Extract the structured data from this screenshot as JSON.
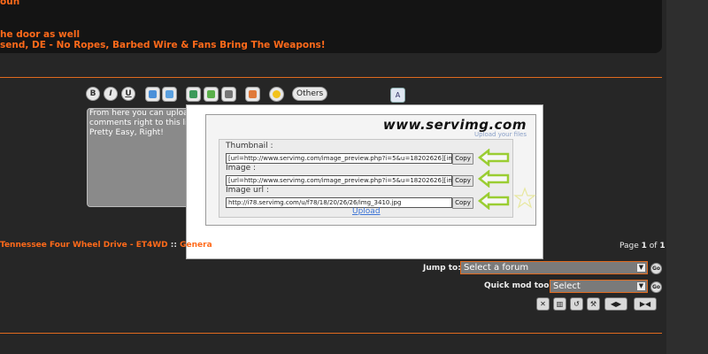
{
  "post": {
    "line1": "oun",
    "line2": "he door as well",
    "line3": "send, DE - No Ropes, Barbed Wire & Fans Bring The Weapons!"
  },
  "toolbar": {
    "bold": "B",
    "italic": "I",
    "underline": "U",
    "others_label": "Others",
    "font_label": "A"
  },
  "editor": {
    "line1": "From here you can uploa",
    "line2": "comments right to this liv",
    "line3": "Pretty Easy, Right!"
  },
  "servimg": {
    "logo": "www.servimg.com",
    "tagline": "Upload your files",
    "thumbnail_label": "Thumbnail :",
    "thumbnail_value": "[url=http://www.servimg.com/image_preview.php?i=5&u=18202626][im",
    "image_label": "Image :",
    "image_value": "[url=http://www.servimg.com/image_preview.php?i=5&u=18202626][im",
    "image_url_label": "Image url :",
    "image_url_value": "http://i78.servimg.com/u/f78/18/20/26/26/img_3410.jpg",
    "copy_label": "Copy",
    "upload_label": "Upload",
    "arrow_color": "#9acd32"
  },
  "footer": {
    "breadcrumb_forum": "Tennessee Four Wheel Drive - ET4WD",
    "breadcrumb_sep": " :: ",
    "breadcrumb_section": "Genera",
    "page_prefix": "Page ",
    "page_current": "1",
    "page_of": " of ",
    "page_total": "1",
    "jump_label": "Jump to:",
    "jump_value": "Select a forum",
    "mod_label": "Quick mod tools:",
    "mod_value": "Select",
    "go_label": "Go"
  },
  "colors": {
    "accent": "#ff6a1a",
    "background": "#262626"
  }
}
